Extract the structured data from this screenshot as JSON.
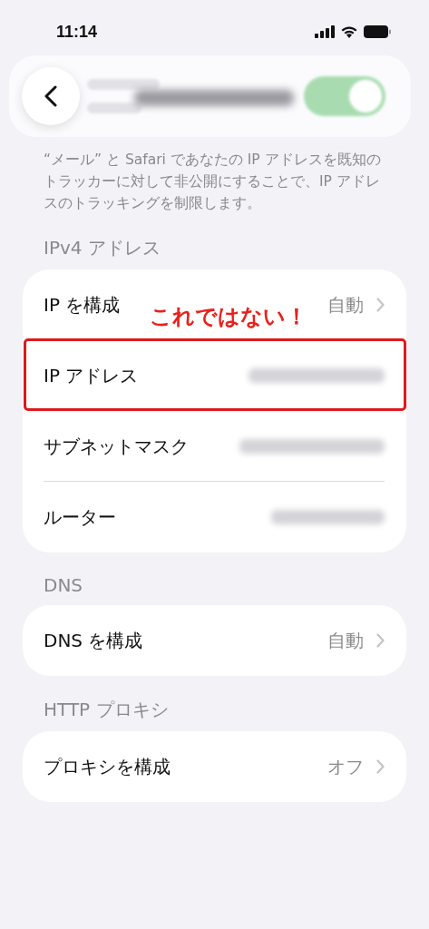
{
  "status_bar": {
    "time": "11:14"
  },
  "top_row": {
    "on": true
  },
  "footer": "“メール” と Safari であなたの IP アドレスを既知のトラッカーに対して非公開にすることで、IP アドレスのトラッキングを制限します。",
  "sections": [
    {
      "header": "IPv4 アドレス",
      "rows": [
        {
          "kind": "link",
          "label": "IP を構成",
          "value": "自動"
        },
        {
          "kind": "redacted",
          "label": "IP アドレス"
        },
        {
          "kind": "redacted",
          "label": "サブネットマスク"
        },
        {
          "kind": "redacted",
          "label": "ルーター"
        }
      ],
      "annotation": {
        "text": "これではない！"
      }
    },
    {
      "header": "DNS",
      "rows": [
        {
          "kind": "link",
          "label": "DNS を構成",
          "value": "自動"
        }
      ]
    },
    {
      "header": "HTTP プロキシ",
      "rows": [
        {
          "kind": "link",
          "label": "プロキシを構成",
          "value": "オフ"
        }
      ]
    }
  ]
}
